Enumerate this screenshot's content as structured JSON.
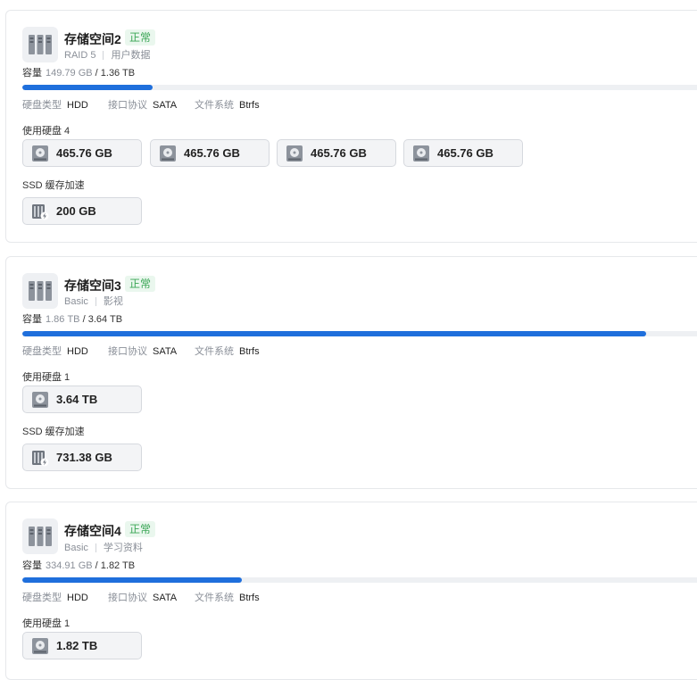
{
  "pools": [
    {
      "name": "存储空间2",
      "status": "正常",
      "raid": "RAID 5",
      "desc": "用户数据",
      "capacity_label": "容量",
      "used": "149.79 GB",
      "total": "/ 1.36 TB",
      "usage_fraction": 0.19,
      "disk_type_label": "硬盘类型",
      "disk_type": "HDD",
      "interface_label": "接口协议",
      "interface": "SATA",
      "fs_label": "文件系统",
      "fs": "Btrfs",
      "disks_label": "使用硬盘 4",
      "disks": [
        "465.76 GB",
        "465.76 GB",
        "465.76 GB",
        "465.76 GB"
      ],
      "ssd_label": "SSD 缓存加速",
      "ssd": [
        "200 GB"
      ]
    },
    {
      "name": "存储空间3",
      "status": "正常",
      "raid": "Basic",
      "desc": "影视",
      "capacity_label": "容量",
      "used": "1.86 TB",
      "total": "/ 3.64 TB",
      "usage_fraction": 0.908,
      "disk_type_label": "硬盘类型",
      "disk_type": "HDD",
      "interface_label": "接口协议",
      "interface": "SATA",
      "fs_label": "文件系统",
      "fs": "Btrfs",
      "disks_label": "使用硬盘 1",
      "disks": [
        "3.64 TB"
      ],
      "ssd_label": "SSD 缓存加速",
      "ssd": [
        "731.38 GB"
      ]
    },
    {
      "name": "存储空间4",
      "status": "正常",
      "raid": "Basic",
      "desc": "学习资料",
      "capacity_label": "容量",
      "used": "334.91 GB",
      "total": "/ 1.82 TB",
      "usage_fraction": 0.32,
      "disk_type_label": "硬盘类型",
      "disk_type": "HDD",
      "interface_label": "接口协议",
      "interface": "SATA",
      "fs_label": "文件系统",
      "fs": "Btrfs",
      "disks_label": "使用硬盘 1",
      "disks": [
        "1.82 TB"
      ]
    }
  ],
  "colors": {
    "accent": "#1f6fdc",
    "status_ok": "#3aa655"
  },
  "icons": {
    "pool": "server-rack-icon",
    "disk": "hard-disk-icon",
    "ssd": "ssd-cache-icon"
  }
}
